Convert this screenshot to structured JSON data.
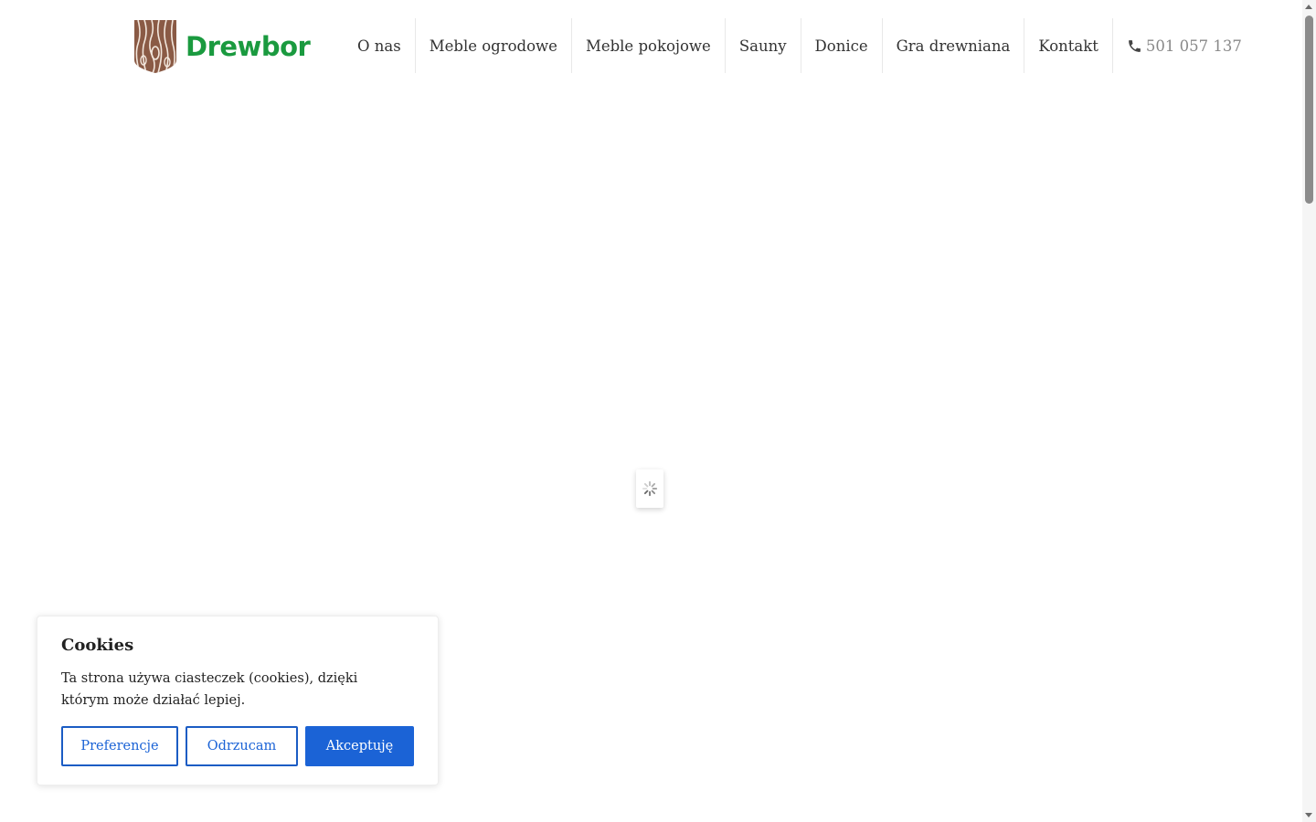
{
  "header": {
    "logo_text": "Drewbor",
    "brand_color": "#1a9a3f",
    "nav": [
      {
        "label": "O nas"
      },
      {
        "label": "Meble ogrodowe"
      },
      {
        "label": "Meble pokojowe"
      },
      {
        "label": "Sauny"
      },
      {
        "label": "Donice"
      },
      {
        "label": "Gra drewniana"
      },
      {
        "label": "Kontakt"
      }
    ],
    "phone": {
      "icon": "phone-icon",
      "number": "501 057 137"
    }
  },
  "loader": {
    "icon": "spinner-icon"
  },
  "cookies": {
    "title": "Cookies",
    "text": "Ta strona używa ciasteczek (cookies), dzięki którym może działać lepiej.",
    "buttons": {
      "preferences": "Preferencje",
      "reject": "Odrzucam",
      "accept": "Akceptuję"
    },
    "accent_color": "#1b63d6"
  }
}
